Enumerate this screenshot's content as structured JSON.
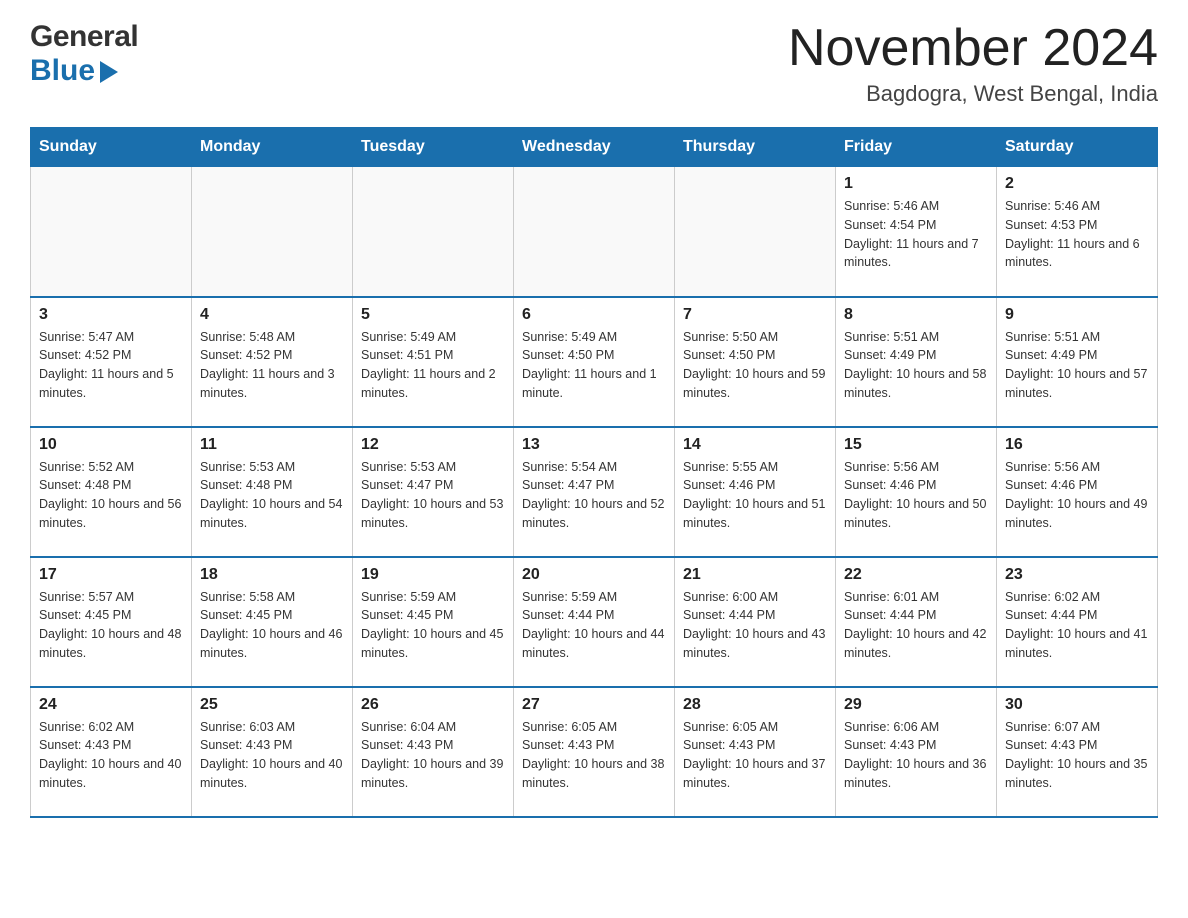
{
  "header": {
    "logo_general": "General",
    "logo_blue": "Blue",
    "month_title": "November 2024",
    "location": "Bagdogra, West Bengal, India"
  },
  "days_of_week": [
    "Sunday",
    "Monday",
    "Tuesday",
    "Wednesday",
    "Thursday",
    "Friday",
    "Saturday"
  ],
  "weeks": [
    [
      {
        "day": "",
        "info": ""
      },
      {
        "day": "",
        "info": ""
      },
      {
        "day": "",
        "info": ""
      },
      {
        "day": "",
        "info": ""
      },
      {
        "day": "",
        "info": ""
      },
      {
        "day": "1",
        "info": "Sunrise: 5:46 AM\nSunset: 4:54 PM\nDaylight: 11 hours and 7 minutes."
      },
      {
        "day": "2",
        "info": "Sunrise: 5:46 AM\nSunset: 4:53 PM\nDaylight: 11 hours and 6 minutes."
      }
    ],
    [
      {
        "day": "3",
        "info": "Sunrise: 5:47 AM\nSunset: 4:52 PM\nDaylight: 11 hours and 5 minutes."
      },
      {
        "day": "4",
        "info": "Sunrise: 5:48 AM\nSunset: 4:52 PM\nDaylight: 11 hours and 3 minutes."
      },
      {
        "day": "5",
        "info": "Sunrise: 5:49 AM\nSunset: 4:51 PM\nDaylight: 11 hours and 2 minutes."
      },
      {
        "day": "6",
        "info": "Sunrise: 5:49 AM\nSunset: 4:50 PM\nDaylight: 11 hours and 1 minute."
      },
      {
        "day": "7",
        "info": "Sunrise: 5:50 AM\nSunset: 4:50 PM\nDaylight: 10 hours and 59 minutes."
      },
      {
        "day": "8",
        "info": "Sunrise: 5:51 AM\nSunset: 4:49 PM\nDaylight: 10 hours and 58 minutes."
      },
      {
        "day": "9",
        "info": "Sunrise: 5:51 AM\nSunset: 4:49 PM\nDaylight: 10 hours and 57 minutes."
      }
    ],
    [
      {
        "day": "10",
        "info": "Sunrise: 5:52 AM\nSunset: 4:48 PM\nDaylight: 10 hours and 56 minutes."
      },
      {
        "day": "11",
        "info": "Sunrise: 5:53 AM\nSunset: 4:48 PM\nDaylight: 10 hours and 54 minutes."
      },
      {
        "day": "12",
        "info": "Sunrise: 5:53 AM\nSunset: 4:47 PM\nDaylight: 10 hours and 53 minutes."
      },
      {
        "day": "13",
        "info": "Sunrise: 5:54 AM\nSunset: 4:47 PM\nDaylight: 10 hours and 52 minutes."
      },
      {
        "day": "14",
        "info": "Sunrise: 5:55 AM\nSunset: 4:46 PM\nDaylight: 10 hours and 51 minutes."
      },
      {
        "day": "15",
        "info": "Sunrise: 5:56 AM\nSunset: 4:46 PM\nDaylight: 10 hours and 50 minutes."
      },
      {
        "day": "16",
        "info": "Sunrise: 5:56 AM\nSunset: 4:46 PM\nDaylight: 10 hours and 49 minutes."
      }
    ],
    [
      {
        "day": "17",
        "info": "Sunrise: 5:57 AM\nSunset: 4:45 PM\nDaylight: 10 hours and 48 minutes."
      },
      {
        "day": "18",
        "info": "Sunrise: 5:58 AM\nSunset: 4:45 PM\nDaylight: 10 hours and 46 minutes."
      },
      {
        "day": "19",
        "info": "Sunrise: 5:59 AM\nSunset: 4:45 PM\nDaylight: 10 hours and 45 minutes."
      },
      {
        "day": "20",
        "info": "Sunrise: 5:59 AM\nSunset: 4:44 PM\nDaylight: 10 hours and 44 minutes."
      },
      {
        "day": "21",
        "info": "Sunrise: 6:00 AM\nSunset: 4:44 PM\nDaylight: 10 hours and 43 minutes."
      },
      {
        "day": "22",
        "info": "Sunrise: 6:01 AM\nSunset: 4:44 PM\nDaylight: 10 hours and 42 minutes."
      },
      {
        "day": "23",
        "info": "Sunrise: 6:02 AM\nSunset: 4:44 PM\nDaylight: 10 hours and 41 minutes."
      }
    ],
    [
      {
        "day": "24",
        "info": "Sunrise: 6:02 AM\nSunset: 4:43 PM\nDaylight: 10 hours and 40 minutes."
      },
      {
        "day": "25",
        "info": "Sunrise: 6:03 AM\nSunset: 4:43 PM\nDaylight: 10 hours and 40 minutes."
      },
      {
        "day": "26",
        "info": "Sunrise: 6:04 AM\nSunset: 4:43 PM\nDaylight: 10 hours and 39 minutes."
      },
      {
        "day": "27",
        "info": "Sunrise: 6:05 AM\nSunset: 4:43 PM\nDaylight: 10 hours and 38 minutes."
      },
      {
        "day": "28",
        "info": "Sunrise: 6:05 AM\nSunset: 4:43 PM\nDaylight: 10 hours and 37 minutes."
      },
      {
        "day": "29",
        "info": "Sunrise: 6:06 AM\nSunset: 4:43 PM\nDaylight: 10 hours and 36 minutes."
      },
      {
        "day": "30",
        "info": "Sunrise: 6:07 AM\nSunset: 4:43 PM\nDaylight: 10 hours and 35 minutes."
      }
    ]
  ]
}
